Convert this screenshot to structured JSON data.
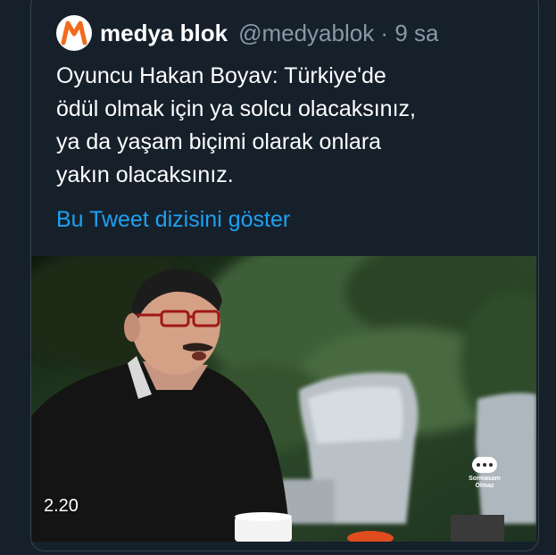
{
  "tweet": {
    "author_name": "medya blok",
    "handle": "@medyablok",
    "time": "9 sa",
    "text_lines": [
      "Oyuncu Hakan Boyav: Türkiye'de",
      "ödül olmak için ya solcu olacaksınız,",
      "ya da yaşam biçimi olarak onlara",
      "yakın olacaksınız."
    ],
    "thread_link": "Bu Tweet dizisini göster",
    "video_duration": "2.20",
    "watermark_line1": "Sormasam",
    "watermark_line2": "Olmaz"
  },
  "colors": {
    "background": "#15202b",
    "border": "#38444d",
    "link": "#1da1f2",
    "muted": "#8899a6",
    "avatar_accent": "#f26b1d"
  }
}
